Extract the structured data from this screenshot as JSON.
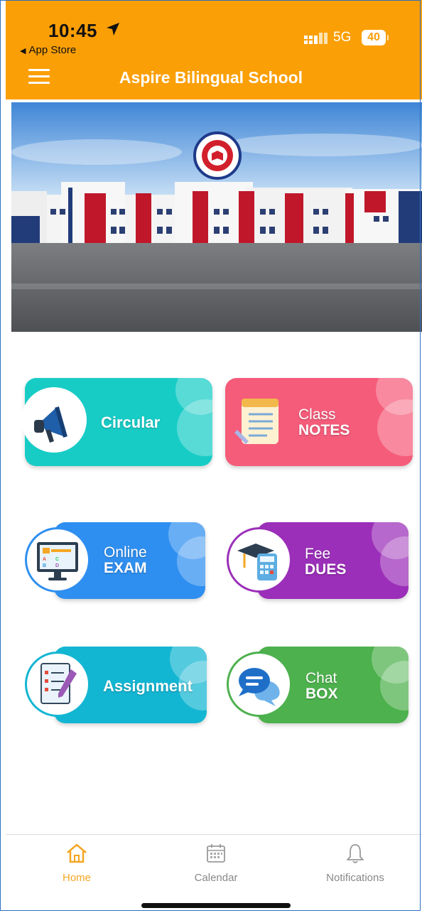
{
  "status_bar": {
    "time": "10:45",
    "back_app": "App Store",
    "network": "5G",
    "battery": "40"
  },
  "header": {
    "title": "Aspire Bilingual School"
  },
  "tiles": [
    {
      "label": "Circular"
    },
    {
      "top": "Class",
      "bottom": "NOTES"
    },
    {
      "top": "Online",
      "bottom": "EXAM"
    },
    {
      "top": "Fee",
      "bottom": "DUES"
    },
    {
      "label": "Assignment"
    },
    {
      "top": "Chat",
      "bottom": "BOX"
    }
  ],
  "tabbar": {
    "home": "Home",
    "calendar": "Calendar",
    "notifications": "Notifications"
  },
  "colors": {
    "header": "#fb9f06",
    "circular": "#18ccc6",
    "class_notes": "#f55c7a",
    "online_exam": "#2f8ff0",
    "fee_dues": "#9b2fb9",
    "assignment": "#13b6d2",
    "chat_box": "#4db14d",
    "active_tab": "#f5a623"
  }
}
